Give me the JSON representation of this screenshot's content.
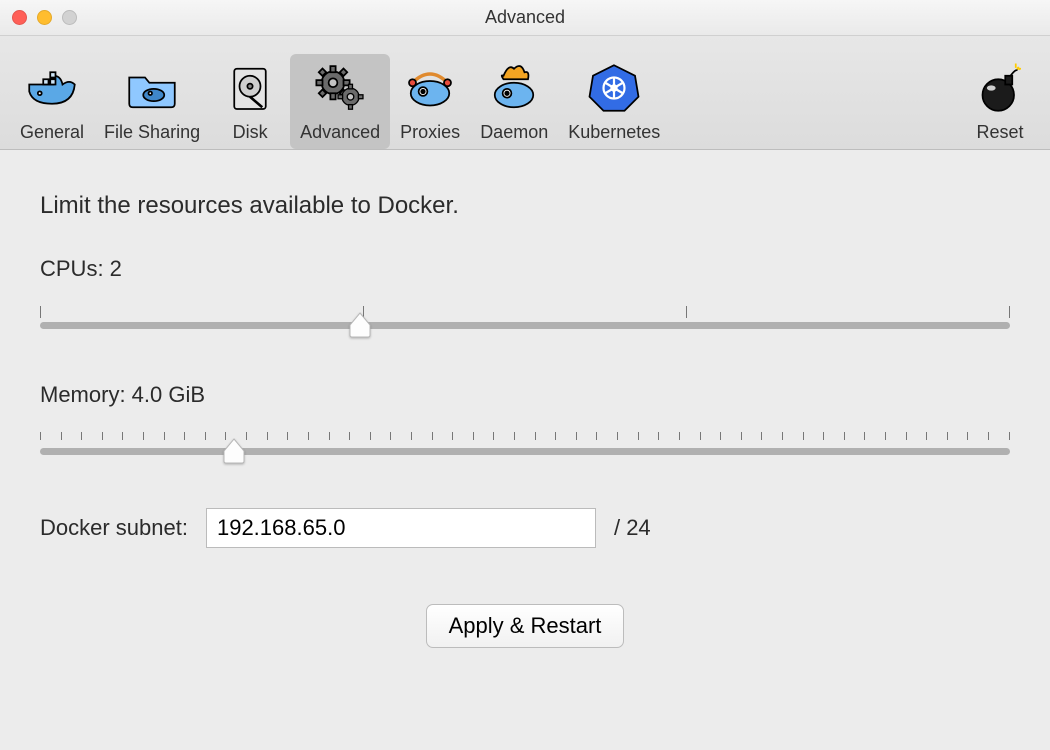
{
  "window": {
    "title": "Advanced"
  },
  "toolbar": {
    "items": [
      {
        "id": "general",
        "label": "General"
      },
      {
        "id": "filesharing",
        "label": "File Sharing"
      },
      {
        "id": "disk",
        "label": "Disk"
      },
      {
        "id": "advanced",
        "label": "Advanced",
        "selected": true
      },
      {
        "id": "proxies",
        "label": "Proxies"
      },
      {
        "id": "daemon",
        "label": "Daemon"
      },
      {
        "id": "kubernetes",
        "label": "Kubernetes"
      },
      {
        "id": "reset",
        "label": "Reset"
      }
    ]
  },
  "main": {
    "heading": "Limit the resources available to Docker.",
    "cpu": {
      "label": "CPUs: 2",
      "value": 2,
      "min": 1,
      "max": 4,
      "ticks": 4,
      "thumb_pct": 33
    },
    "memory": {
      "label": "Memory: 4.0 GiB",
      "value": 4.0,
      "min": 1.0,
      "max": 24.0,
      "ticks": 48,
      "thumb_pct": 20
    },
    "subnet": {
      "label": "Docker subnet:",
      "value": "192.168.65.0",
      "suffix": "/ 24"
    },
    "apply": {
      "label": "Apply & Restart"
    }
  }
}
